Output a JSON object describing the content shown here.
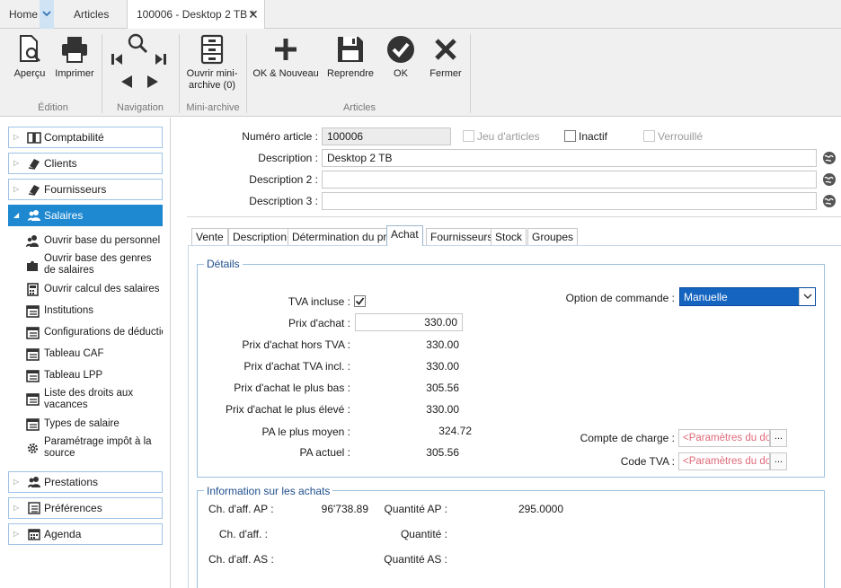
{
  "tabs": {
    "home": "Home",
    "articles": "Articles",
    "document": "100006 - Desktop 2 TB *"
  },
  "ribbon": {
    "apercu": "Aperçu",
    "imprimer": "Imprimer",
    "group_edition": "Édition",
    "group_navigation": "Navigation",
    "ouvrir_mini_archive_line1": "Ouvrir mini-",
    "ouvrir_mini_archive_line2": "archive (0)",
    "group_mini_archive": "Mini-archive",
    "ok_nouveau": "OK & Nouveau",
    "reprendre": "Reprendre",
    "ok": "OK",
    "fermer": "Fermer",
    "group_articles": "Articles"
  },
  "sidebar": {
    "categories": [
      {
        "label": "Comptabilité"
      },
      {
        "label": "Clients"
      },
      {
        "label": "Fournisseurs"
      },
      {
        "label": "Salaires"
      }
    ],
    "salaires_items": [
      {
        "label": "Ouvrir base du personnel"
      },
      {
        "label": "Ouvrir base des genres de salaires"
      },
      {
        "label": "Ouvrir calcul des salaires"
      },
      {
        "label": "Institutions"
      },
      {
        "label": "Configurations de déductic"
      },
      {
        "label": "Tableau CAF"
      },
      {
        "label": "Tableau LPP"
      },
      {
        "label": "Liste des droits aux vacances"
      },
      {
        "label": "Types de salaire"
      },
      {
        "label": "Paramétrage impôt à la source"
      }
    ],
    "bottom_categories": [
      {
        "label": "Prestations"
      },
      {
        "label": "Préférences"
      },
      {
        "label": "Agenda"
      }
    ]
  },
  "form": {
    "numero_label": "Numéro article :",
    "numero_value": "100006",
    "jeu_articles": "Jeu d'articles",
    "inactif": "Inactif",
    "verrouille": "Verrouillé",
    "description_label": "Description :",
    "description_value": "Desktop 2 TB",
    "description2_label": "Description 2 :",
    "description3_label": "Description 3 :"
  },
  "inner_tabs": [
    "Vente",
    "Description",
    "Détermination du prix",
    "Achat",
    "Fournisseurs",
    "Stock",
    "Groupes"
  ],
  "details": {
    "title": "Détails",
    "tva_incluse_label": "TVA incluse :",
    "tva_incluse_checked": true,
    "prix_achat_label": "Prix d'achat :",
    "prix_achat_value": "330.00",
    "prix_achat_hors_tva_label": "Prix d'achat hors TVA :",
    "prix_achat_hors_tva_value": "330.00",
    "prix_achat_tva_incl_label": "Prix d'achat TVA incl. :",
    "prix_achat_tva_incl_value": "330.00",
    "prix_plus_bas_label": "Prix d'achat le plus bas :",
    "prix_plus_bas_value": "305.56",
    "prix_plus_eleve_label": "Prix d'achat le plus élevé :",
    "prix_plus_eleve_value": "330.00",
    "pa_plus_moyen_label": "PA le plus moyen :",
    "pa_plus_moyen_value": "324.72",
    "pa_actuel_label": "PA actuel :",
    "pa_actuel_value": "305.56",
    "option_commande_label": "Option de commande :",
    "option_commande_value": "Manuelle",
    "compte_charge_label": "Compte de charge :",
    "compte_charge_value": "<Paramètres du dossier>",
    "code_tva_label": "Code TVA :",
    "code_tva_value": "<Paramètres du dossier>",
    "dots": "..."
  },
  "achats": {
    "title": "Information sur les achats",
    "ch_aff_ap_label": "Ch. d'aff. AP :",
    "ch_aff_ap_value": "96'738.89",
    "quantite_ap_label": "Quantité AP :",
    "quantite_ap_value": "295.0000",
    "ch_aff_label": "Ch. d'aff. :",
    "quantite_label": "Quantité :",
    "ch_aff_as_label": "Ch. d'aff. AS :",
    "quantite_as_label": "Quantité AS :"
  },
  "colors": {
    "accent": "#1e88d0",
    "ribbon_bg": "#f0f0f0",
    "select_bg": "#1565c0",
    "link_blue": "#1e4e8c",
    "placeholder_pink": "#e06a7a"
  }
}
